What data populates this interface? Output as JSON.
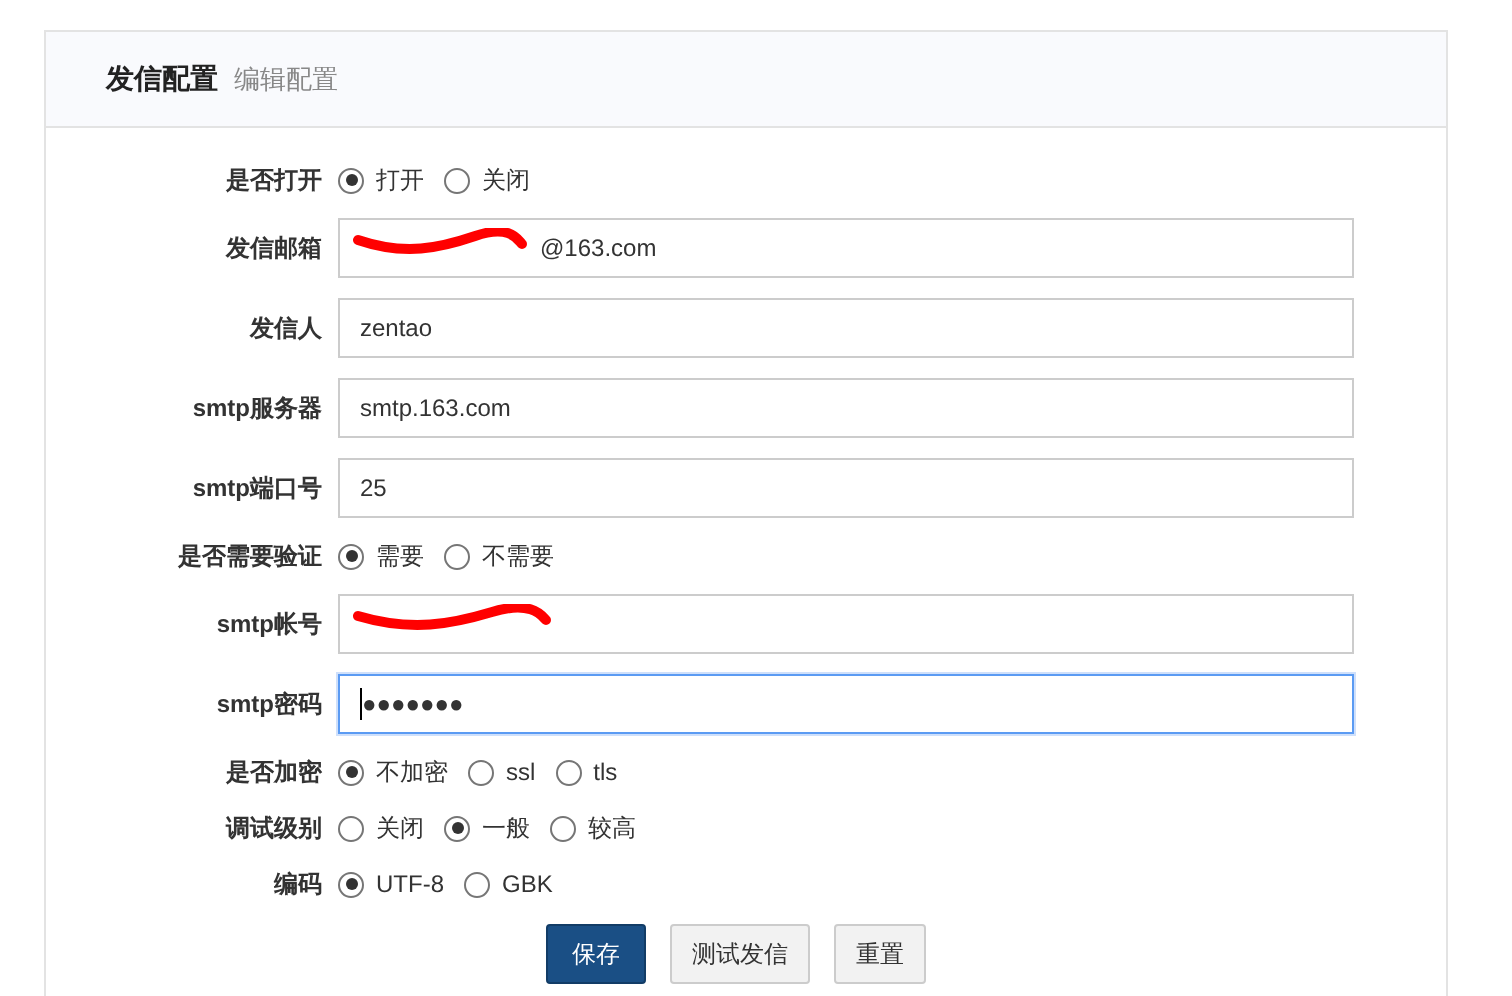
{
  "header": {
    "title": "发信配置",
    "subtitle": "编辑配置"
  },
  "fields": [
    {
      "kind": "radio",
      "label": "是否打开",
      "options": [
        {
          "label": "打开",
          "selected": true
        },
        {
          "label": "关闭",
          "selected": false
        }
      ]
    },
    {
      "kind": "text",
      "label": "发信邮箱",
      "value": "@163.com",
      "redacted": true
    },
    {
      "kind": "text",
      "label": "发信人",
      "value": "zentao"
    },
    {
      "kind": "text",
      "label": "smtp服务器",
      "value": "smtp.163.com"
    },
    {
      "kind": "text",
      "label": "smtp端口号",
      "value": "25"
    },
    {
      "kind": "radio",
      "label": "是否需要验证",
      "options": [
        {
          "label": "需要",
          "selected": true
        },
        {
          "label": "不需要",
          "selected": false
        }
      ]
    },
    {
      "kind": "text",
      "label": "smtp帐号",
      "redacted": true
    },
    {
      "kind": "password",
      "label": "smtp密码",
      "value": "●●●●●●●",
      "focused": true
    },
    {
      "kind": "radio",
      "label": "是否加密",
      "options": [
        {
          "label": "不加密",
          "selected": true
        },
        {
          "label": "ssl",
          "selected": false
        },
        {
          "label": "tls",
          "selected": false
        }
      ]
    },
    {
      "kind": "radio",
      "label": "调试级别",
      "options": [
        {
          "label": "关闭",
          "selected": false
        },
        {
          "label": "一般",
          "selected": true
        },
        {
          "label": "较高",
          "selected": false
        }
      ]
    },
    {
      "kind": "radio",
      "label": "编码",
      "options": [
        {
          "label": "UTF-8",
          "selected": true
        },
        {
          "label": "GBK",
          "selected": false
        }
      ]
    }
  ],
  "buttons": [
    {
      "label": "保存",
      "kind": "primary"
    },
    {
      "label": "测试发信",
      "kind": "default"
    },
    {
      "label": "重置",
      "kind": "default"
    }
  ]
}
